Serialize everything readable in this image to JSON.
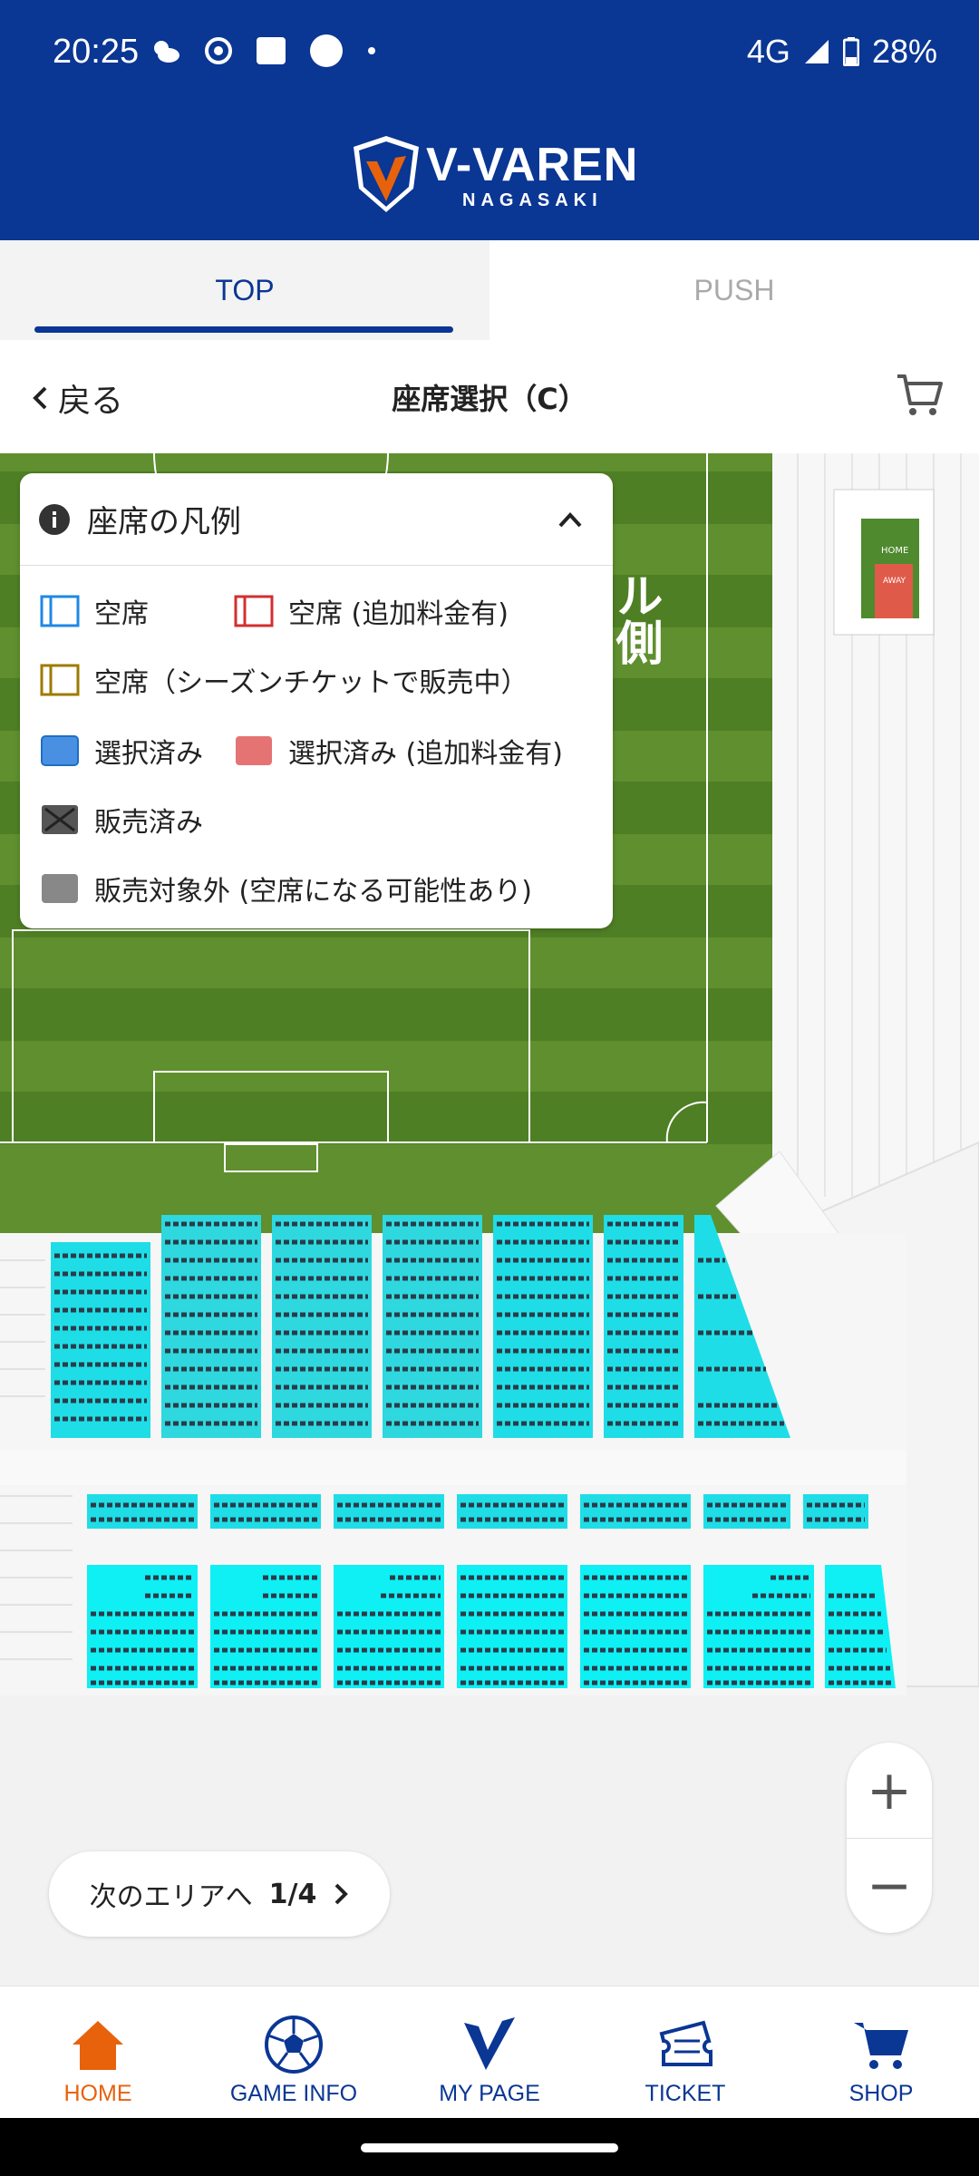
{
  "status_bar": {
    "time": "20:25",
    "network": "4G",
    "battery": "28%"
  },
  "brand": {
    "name": "V-VAREN",
    "sub": "NAGASAKI"
  },
  "tabs": [
    {
      "label": "TOP"
    },
    {
      "label": "PUSH"
    }
  ],
  "header": {
    "back_label": "戻る",
    "title": "座席選択（C）"
  },
  "map": {
    "goal_side_label": "ル側",
    "home_label": "HOME",
    "away_label": "AWAY"
  },
  "legend": {
    "title": "座席の凡例",
    "items": [
      {
        "label": "空席",
        "color": "#1e88e5"
      },
      {
        "label": "空席 (追加料金有)",
        "color": "#d32f2f"
      },
      {
        "label": "空席（シーズンチケットで販売中）",
        "color": "#9e7a00"
      },
      {
        "label": "選択済み",
        "color": "#4a90e2"
      },
      {
        "label": "選択済み (追加料金有)",
        "color": "#e57373"
      },
      {
        "label": "販売済み",
        "color": "#555555"
      },
      {
        "label": "販売対象外 (空席になる可能性あり)",
        "color": "#888888"
      }
    ]
  },
  "next_area": {
    "label": "次のエリアへ",
    "count": "1/4"
  },
  "zoom": {
    "in": "+",
    "out": "−"
  },
  "bottom_nav": [
    {
      "label": "HOME",
      "icon": "home-icon",
      "color": "#e8620c"
    },
    {
      "label": "GAME INFO",
      "icon": "soccer-ball-icon",
      "color": "#0a3694"
    },
    {
      "label": "MY PAGE",
      "icon": "v-logo-icon",
      "color": "#0a3694"
    },
    {
      "label": "TICKET",
      "icon": "ticket-icon",
      "color": "#0a3694"
    },
    {
      "label": "SHOP",
      "icon": "cart-icon",
      "color": "#0a3694"
    }
  ]
}
